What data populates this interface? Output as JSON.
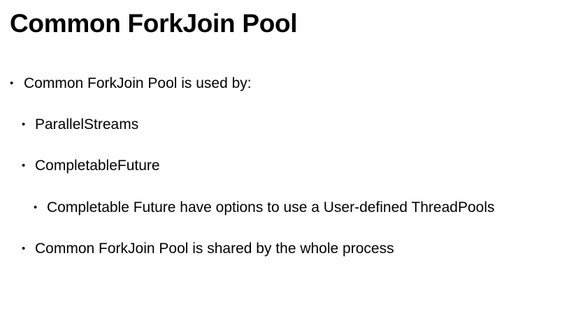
{
  "slide": {
    "title": "Common ForkJoin Pool",
    "bullets": [
      {
        "marker": "•",
        "text": "Common ForkJoin Pool is used by:"
      },
      {
        "marker": "•",
        "text": "ParallelStreams"
      },
      {
        "marker": "•",
        "text": "CompletableFuture"
      },
      {
        "marker": "•",
        "text": "Completable Future have options to use a User-defined ThreadPools"
      },
      {
        "marker": "•",
        "text": "Common ForkJoin Pool is shared by the whole process"
      }
    ]
  },
  "colors": {
    "background": "#ffffff",
    "text": "#000000"
  }
}
